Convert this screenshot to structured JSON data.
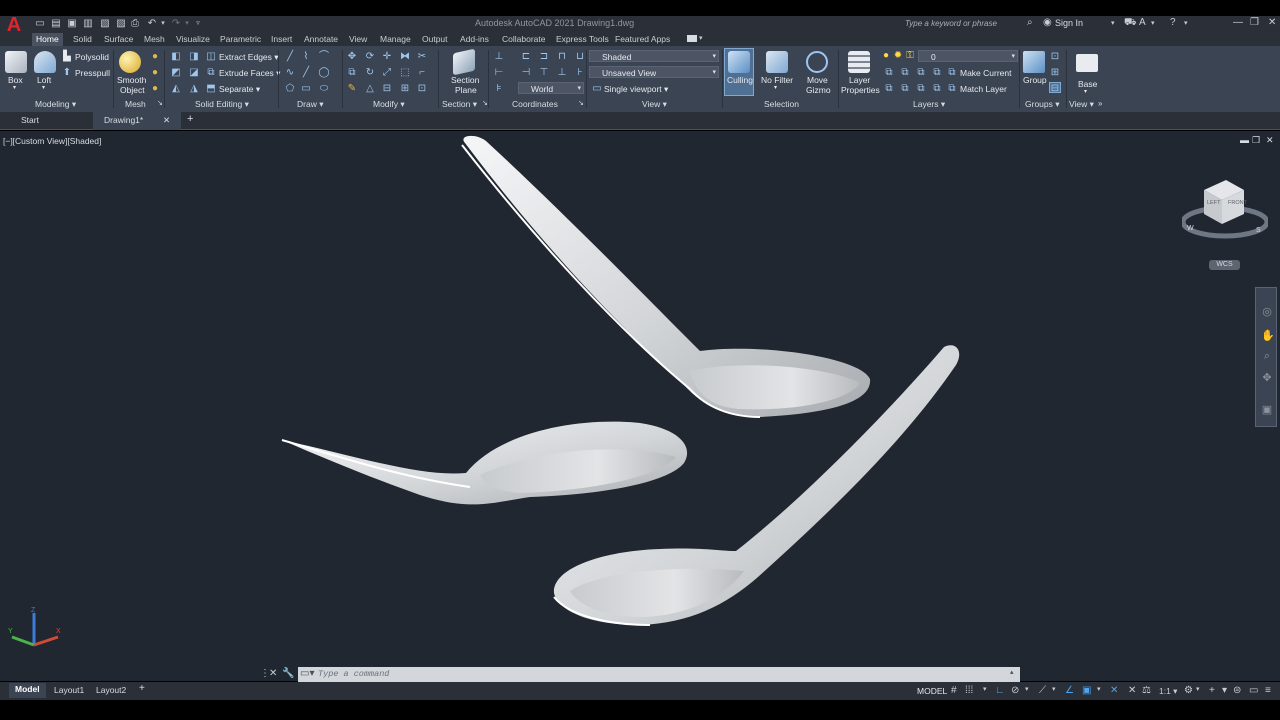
{
  "app": {
    "logo_letter": "A",
    "title": "Autodesk AutoCAD 2021    Drawing1.dwg",
    "search_placeholder": "Type a keyword or phrase",
    "sign_in": "Sign In"
  },
  "ribbon_tabs": [
    "Home",
    "Solid",
    "Surface",
    "Mesh",
    "Visualize",
    "Parametric",
    "Insert",
    "Annotate",
    "View",
    "Manage",
    "Output",
    "Add-ins",
    "Collaborate",
    "Express Tools",
    "Featured Apps"
  ],
  "active_tab": "Home",
  "panels": {
    "modeling": {
      "title": "Modeling ▾",
      "box": "Box",
      "loft": "Loft",
      "polysolid": "Polysolid",
      "presspull": "Presspull"
    },
    "mesh": {
      "title": "Mesh",
      "smooth_object_line1": "Smooth",
      "smooth_object_line2": "Object"
    },
    "solid_editing": {
      "title": "Solid Editing ▾",
      "extract_edges": "Extract Edges ▾",
      "extrude_faces": "Extrude Faces ▾",
      "separate": "Separate ▾"
    },
    "draw": {
      "title": "Draw ▾"
    },
    "modify": {
      "title": "Modify ▾"
    },
    "section": {
      "title": "Section ▾",
      "section_plane_line1": "Section",
      "section_plane_line2": "Plane"
    },
    "coordinates": {
      "title": "Coordinates",
      "world": "World"
    },
    "view": {
      "title": "View ▾",
      "visual_style": "Shaded",
      "saved_view": "Unsaved View",
      "viewport": "Single viewport ▾"
    },
    "selection": {
      "title": "Selection",
      "culling": "Culling",
      "no_filter": "No Filter",
      "move_gizmo_line1": "Move",
      "move_gizmo_line2": "Gizmo"
    },
    "layers": {
      "title": "Layers ▾",
      "layer_properties_line1": "Layer",
      "layer_properties_line2": "Properties",
      "current_layer": "0",
      "make_current": "Make Current",
      "match_layer": "Match Layer"
    },
    "groups": {
      "title": "Groups ▾",
      "group": "Group"
    },
    "view2": {
      "title": "View ▾",
      "base": "Base"
    }
  },
  "doc_tabs": {
    "start": "Start",
    "drawing": "Drawing1*",
    "close": "✕",
    "add": "+"
  },
  "viewport": {
    "label": "[−][Custom View][Shaded]",
    "viewcube_left": "LEFT",
    "viewcube_front": "FRONT",
    "compass_w": "W",
    "compass_s": "S",
    "wcs": "WCS",
    "ucs_x": "X",
    "ucs_y": "Y",
    "ucs_z": "Z"
  },
  "command_line": {
    "placeholder": "Type  a  command"
  },
  "layout_tabs": [
    "Model",
    "Layout1",
    "Layout2"
  ],
  "status": {
    "model": "MODEL",
    "scale": "1:1 ▾"
  },
  "colors": {
    "accent_red": "#e0242b",
    "ribbon_bg": "#3b4453",
    "viewport_bg": "#212730",
    "active_blue": "#4fa4f0"
  }
}
